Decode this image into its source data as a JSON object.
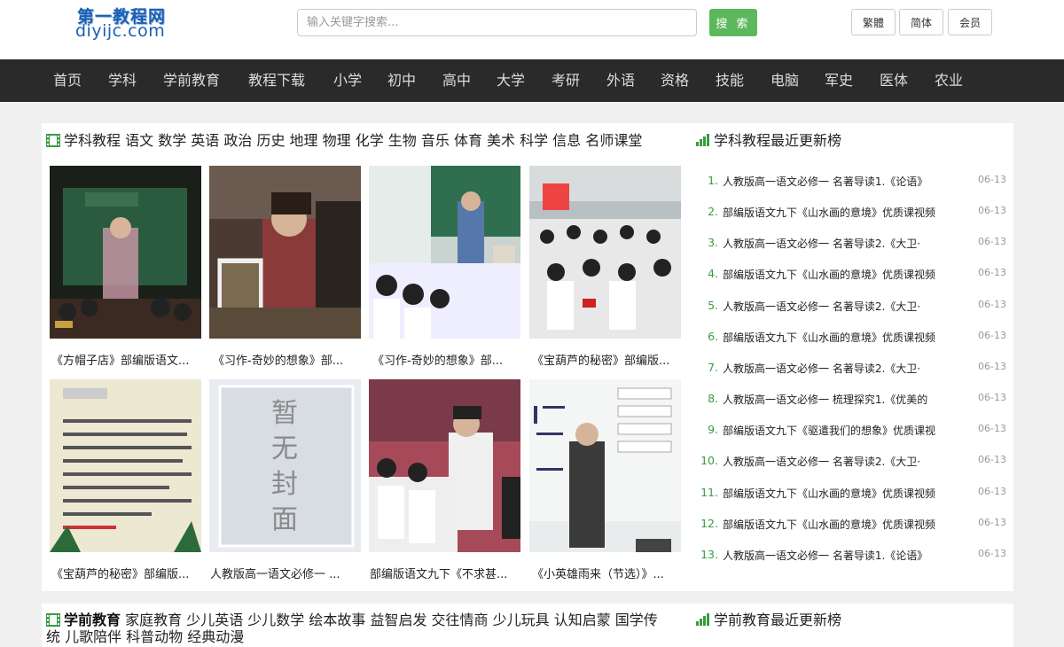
{
  "header": {
    "logo_cn": "第一教程网",
    "logo_en": "diyijc.com",
    "search_placeholder": "输入关键字搜索...",
    "search_button": "搜 索",
    "btn_traditional": "繁體",
    "btn_simplified": "简体",
    "btn_member": "会员"
  },
  "nav": [
    "首页",
    "学科",
    "学前教育",
    "教程下载",
    "小学",
    "初中",
    "高中",
    "大学",
    "考研",
    "外语",
    "资格",
    "技能",
    "电脑",
    "军史",
    "医体",
    "农业"
  ],
  "section1": {
    "title_main": "学科教程",
    "title_tags": "语文 数学 英语 政治 历史 地理 物理 化学 生物 音乐 体育 美术 科学 信息 名师课堂",
    "cards": [
      {
        "caption": "《方帽子店》部编版语文..."
      },
      {
        "caption": "《习作-奇妙的想象》部..."
      },
      {
        "caption": "《习作-奇妙的想象》部..."
      },
      {
        "caption": "《宝葫芦的秘密》部编版..."
      },
      {
        "caption": "《宝葫芦的秘密》部编版..."
      },
      {
        "caption": "人教版高一语文必修一 ..."
      },
      {
        "caption": "部编版语文九下《不求甚..."
      },
      {
        "caption": "《小英雄雨来（节选）》..."
      }
    ],
    "cover_placeholder": [
      "暂",
      "无",
      "封",
      "面"
    ]
  },
  "ranking1": {
    "title": "学科教程最近更新榜",
    "items": [
      {
        "num": "1.",
        "title": "人教版高一语文必修一 名著导读1.《论语》",
        "date": "06-13"
      },
      {
        "num": "2.",
        "title": "部编版语文九下《山水画的意境》优质课视频",
        "date": "06-13"
      },
      {
        "num": "3.",
        "title": "人教版高一语文必修一 名著导读2.《大卫·",
        "date": "06-13"
      },
      {
        "num": "4.",
        "title": "部编版语文九下《山水画的意境》优质课视频",
        "date": "06-13"
      },
      {
        "num": "5.",
        "title": "人教版高一语文必修一 名著导读2.《大卫·",
        "date": "06-13"
      },
      {
        "num": "6.",
        "title": "部编版语文九下《山水画的意境》优质课视频",
        "date": "06-13"
      },
      {
        "num": "7.",
        "title": "人教版高一语文必修一 名著导读2.《大卫·",
        "date": "06-13"
      },
      {
        "num": "8.",
        "title": "人教版高一语文必修一 梳理探究1.《优美的",
        "date": "06-13"
      },
      {
        "num": "9.",
        "title": "部编版语文九下《驱遣我们的想象》优质课视",
        "date": "06-13"
      },
      {
        "num": "10.",
        "title": "人教版高一语文必修一 名著导读2.《大卫·",
        "date": "06-13"
      },
      {
        "num": "11.",
        "title": "部编版语文九下《山水画的意境》优质课视频",
        "date": "06-13"
      },
      {
        "num": "12.",
        "title": "部编版语文九下《山水画的意境》优质课视频",
        "date": "06-13"
      },
      {
        "num": "13.",
        "title": "人教版高一语文必修一 名著导读1.《论语》",
        "date": "06-13"
      }
    ]
  },
  "section2": {
    "title_main": "学前教育",
    "title_tags_line1": "家庭教育 少儿英语 少儿数学 绘本故事 益智启发 交往情商 少儿玩具 认知启蒙 国学传",
    "title_tags_line2": "统 儿歌陪伴 科普动物 经典动漫"
  },
  "ranking2": {
    "title": "学前教育最近更新榜"
  },
  "colors": {
    "accent_green": "#5cb85c",
    "nav_bg": "#2a2a2a",
    "rank_green": "#3a9b44"
  }
}
